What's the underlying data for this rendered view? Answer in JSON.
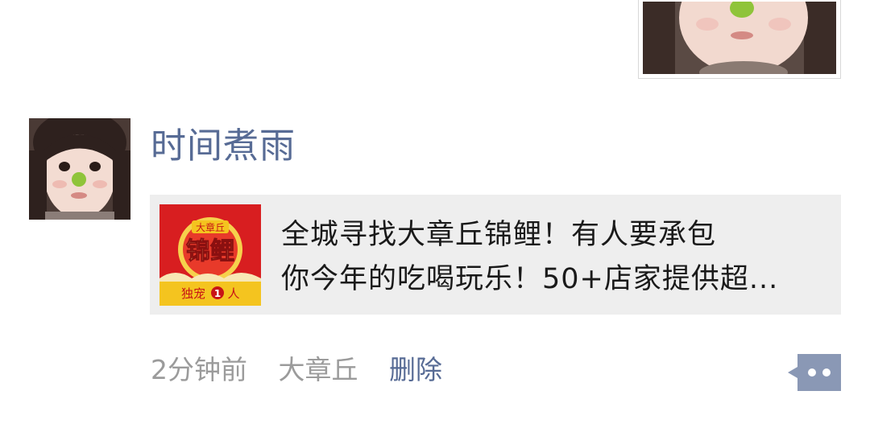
{
  "post": {
    "username": "时间煮雨",
    "link_card": {
      "thumbnail": {
        "small_title": "大章丘",
        "big_title": "锦鲤",
        "footer": "独宠",
        "footer_number": "1",
        "footer_suffix": "人"
      },
      "title_line1": "全城寻找大章丘锦鲤！有人要承包",
      "title_line2": "你今年的吃喝玩乐！50+店家提供超..."
    },
    "meta": {
      "time": "2分钟前",
      "location": "大章丘",
      "delete_label": "删除"
    }
  },
  "colors": {
    "link_blue": "#576b95",
    "meta_gray": "#9b9b9b",
    "card_bg": "#eeeeee",
    "thumb_red": "#d81e20",
    "thumb_yellow": "#f4c41f"
  },
  "icons": {
    "more": "more-dots-icon"
  }
}
